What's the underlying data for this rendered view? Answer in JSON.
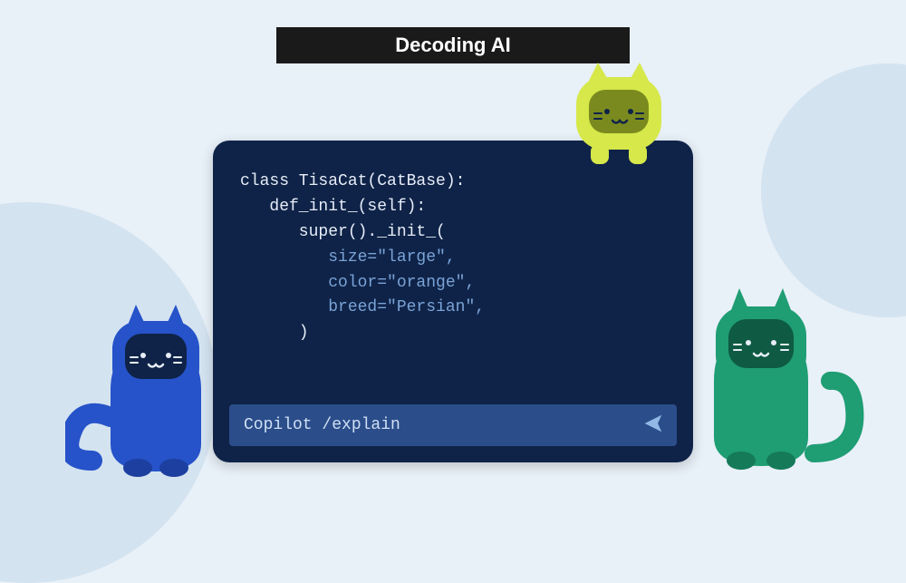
{
  "title": "Decoding AI",
  "code": {
    "line1": "class TisaCat(CatBase):",
    "line2": "   def_init_(self):",
    "line3": "      super()._init_(",
    "line4": "         size=\"large\",",
    "line5": "         color=\"orange\",",
    "line6": "         breed=\"Persian\",",
    "line7": "      )"
  },
  "copilot": {
    "prompt": "Copilot /explain"
  },
  "cats": {
    "yellow": "yellow-cat",
    "blue": "blue-cat",
    "green": "green-cat"
  }
}
